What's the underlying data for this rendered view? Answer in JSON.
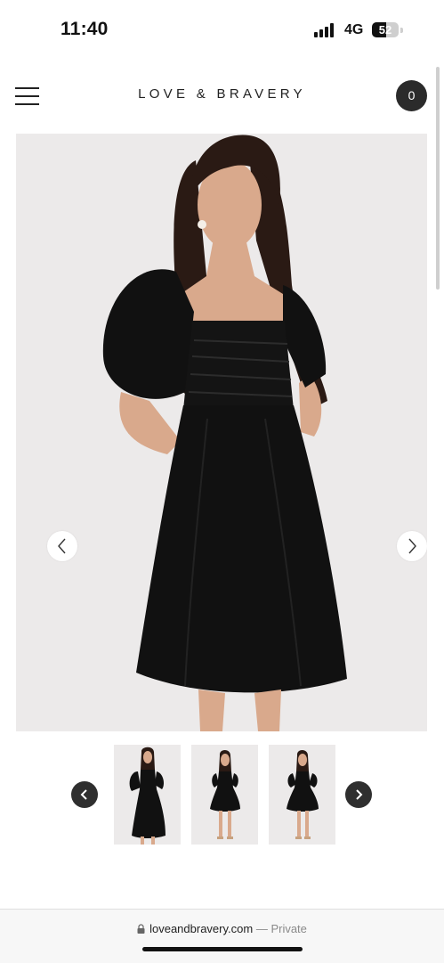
{
  "status_bar": {
    "time": "11:40",
    "network": "4G",
    "battery_percent": "52",
    "battery_level": 0.52
  },
  "header": {
    "menu_icon": "hamburger-menu-icon",
    "brand": "LOVE & BRAVERY",
    "cart_count": "0"
  },
  "product_gallery": {
    "main_image": "model wearing black puff-sleeve square-neck mini dress",
    "prev_icon": "chevron-left-icon",
    "next_icon": "chevron-right-icon",
    "thumbnail_count": 3
  },
  "browser": {
    "url": "loveandbravery.com",
    "separator": "—",
    "mode": "Private",
    "lock_icon": "lock-icon"
  },
  "colors": {
    "dress": "#111111",
    "background": "#eceaea",
    "cart_badge": "#2b2b2b",
    "skin": "#d9a98c",
    "hair": "#2a1a14"
  }
}
